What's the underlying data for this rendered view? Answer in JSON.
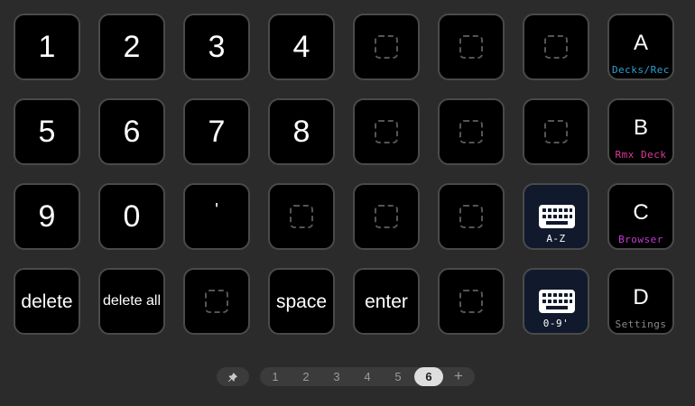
{
  "grid": {
    "keys": [
      {
        "type": "label",
        "text": "1",
        "size": "big"
      },
      {
        "type": "label",
        "text": "2",
        "size": "big"
      },
      {
        "type": "label",
        "text": "3",
        "size": "big"
      },
      {
        "type": "label",
        "text": "4",
        "size": "big"
      },
      {
        "type": "empty"
      },
      {
        "type": "empty"
      },
      {
        "type": "empty"
      },
      {
        "type": "deck",
        "text": "A",
        "sublabel": "Decks/Rec",
        "color": "#2e9fd0"
      },
      {
        "type": "label",
        "text": "5",
        "size": "big"
      },
      {
        "type": "label",
        "text": "6",
        "size": "big"
      },
      {
        "type": "label",
        "text": "7",
        "size": "big"
      },
      {
        "type": "label",
        "text": "8",
        "size": "big"
      },
      {
        "type": "empty"
      },
      {
        "type": "empty"
      },
      {
        "type": "empty"
      },
      {
        "type": "deck",
        "text": "B",
        "sublabel": "Rmx Deck",
        "color": "#e0389a"
      },
      {
        "type": "label",
        "text": "9",
        "size": "big"
      },
      {
        "type": "label",
        "text": "0",
        "size": "big"
      },
      {
        "type": "label",
        "text": "'",
        "size": "apos"
      },
      {
        "type": "empty"
      },
      {
        "type": "empty"
      },
      {
        "type": "empty"
      },
      {
        "type": "keyboard",
        "caption": "A-Z",
        "icon": "keyboard-icon"
      },
      {
        "type": "deck",
        "text": "C",
        "sublabel": "Browser",
        "color": "#c43ad6"
      },
      {
        "type": "label",
        "text": "delete",
        "size": "word"
      },
      {
        "type": "label",
        "text": "delete all",
        "size": "word-sm"
      },
      {
        "type": "empty"
      },
      {
        "type": "label",
        "text": "space",
        "size": "word"
      },
      {
        "type": "label",
        "text": "enter",
        "size": "word"
      },
      {
        "type": "empty"
      },
      {
        "type": "keyboard",
        "caption": "0-9'",
        "icon": "keyboard-icon"
      },
      {
        "type": "deck",
        "text": "D",
        "sublabel": "Settings",
        "color": "#8a8a8a"
      }
    ]
  },
  "pager": {
    "pin_icon": "pin-icon",
    "pages": [
      "1",
      "2",
      "3",
      "4",
      "5",
      "6"
    ],
    "active_page": "6",
    "add_label": "+"
  }
}
